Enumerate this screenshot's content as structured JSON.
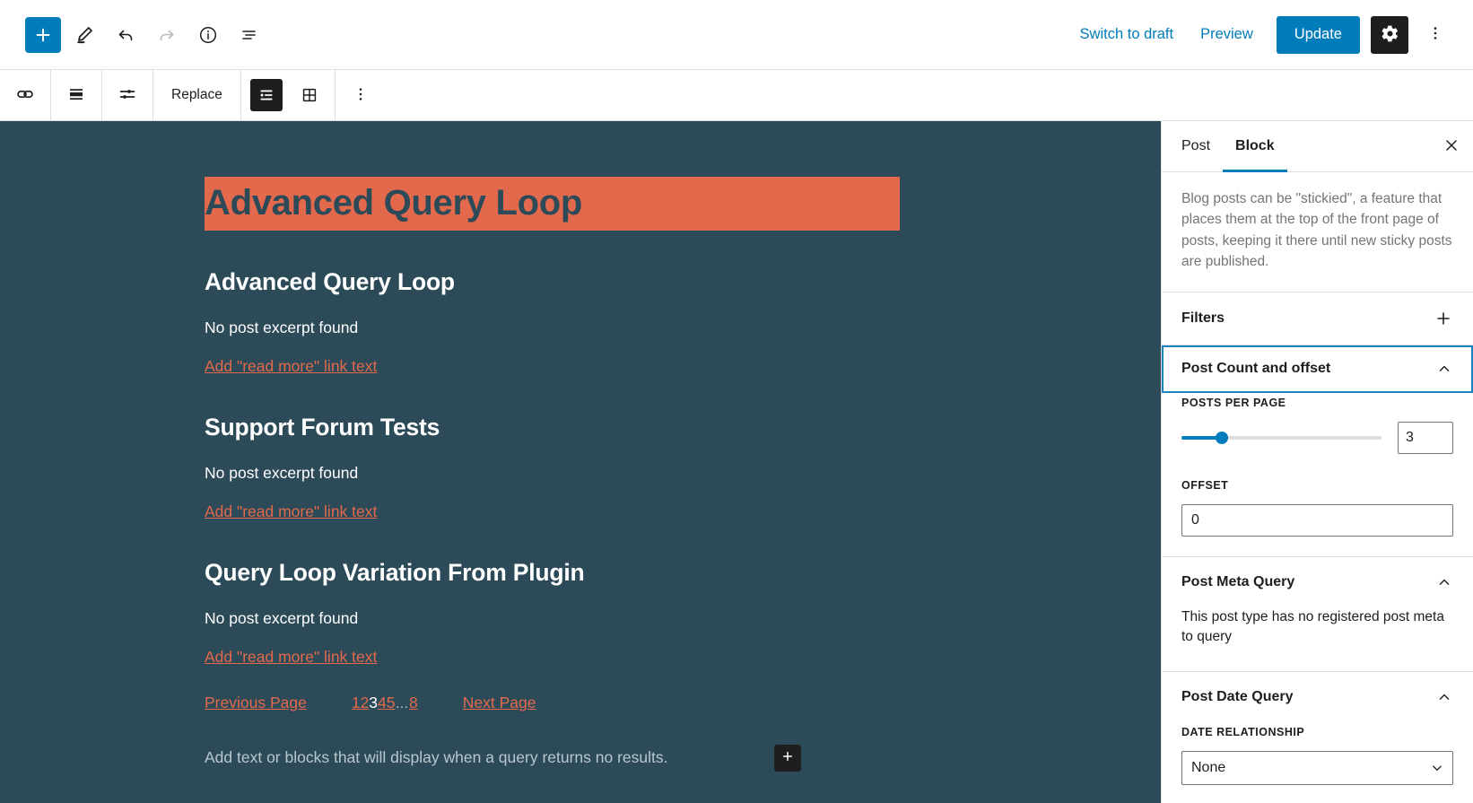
{
  "topbar": {
    "icons": {
      "inserter": "plus-icon",
      "tools": "pencil-icon",
      "undo": "undo-arrow-icon",
      "redo": "redo-arrow-icon",
      "details": "info-circle-icon",
      "list_view": "list-view-icon"
    },
    "switch_to_draft": "Switch to draft",
    "preview": "Preview",
    "update": "Update",
    "settings_icon": "gear-icon",
    "options_icon": "kebab-menu-icon"
  },
  "block_toolbar": {
    "items": [
      {
        "icon": "query-loop-block-icon",
        "label": ""
      },
      {
        "icon": "align-icon",
        "label": ""
      },
      {
        "icon": "display-settings-icon",
        "label": ""
      }
    ],
    "replace_label": "Replace",
    "view_list_icon": "list-layout-icon",
    "view_grid_icon": "grid-layout-icon",
    "more_icon": "kebab-menu-icon"
  },
  "canvas": {
    "post_title": "Advanced Query Loop",
    "posts": [
      {
        "title": "Advanced Query Loop",
        "excerpt": "No post excerpt found",
        "read_more": "Add \"read more\" link text"
      },
      {
        "title": "Support Forum Tests",
        "excerpt": "No post excerpt found",
        "read_more": "Add \"read more\" link text"
      },
      {
        "title": "Query Loop Variation From Plugin",
        "excerpt": "No post excerpt found",
        "read_more": "Add \"read more\" link text"
      }
    ],
    "pagination": {
      "previous": "Previous Page",
      "next": "Next Page",
      "pages": [
        "1",
        "2",
        "3",
        "4",
        "5"
      ],
      "current": "3",
      "ellipsis": "…",
      "last": "8"
    },
    "no_results_placeholder": "Add text or blocks that will display when a query returns no results.",
    "add_block_icon": "plus-icon",
    "colors": {
      "background": "#2c4a58",
      "highlight": "#e2694c",
      "text": "#ffffff"
    }
  },
  "sidebar": {
    "tabs": [
      {
        "label": "Post",
        "active": false
      },
      {
        "label": "Block",
        "active": true
      }
    ],
    "close_icon": "close-x-icon",
    "help_text": "Blog posts can be \"stickied\", a feature that places them at the top of the front page of posts, keeping it there until new sticky posts are published.",
    "panels": [
      {
        "title": "Filters",
        "control": "plus-icon",
        "expanded": false,
        "focused": false
      },
      {
        "title": "Post Count and offset",
        "control": "chevron-up-icon",
        "expanded": true,
        "focused": true,
        "fields": {
          "posts_per_page_label": "POSTS PER PAGE",
          "posts_per_page_value": "3",
          "slider_percent": 20,
          "offset_label": "OFFSET",
          "offset_value": "0"
        }
      },
      {
        "title": "Post Meta Query",
        "control": "chevron-up-icon",
        "expanded": true,
        "focused": false,
        "note": "This post type has no registered post meta to query"
      },
      {
        "title": "Post Date Query",
        "control": "chevron-up-icon",
        "expanded": true,
        "focused": false,
        "fields": {
          "date_relationship_label": "DATE RELATIONSHIP",
          "date_relationship_value": "None"
        }
      }
    ]
  },
  "colors": {
    "accent": "#007cba",
    "focus_border": "#1a84c1",
    "panel_border": "#e0e0e0"
  }
}
